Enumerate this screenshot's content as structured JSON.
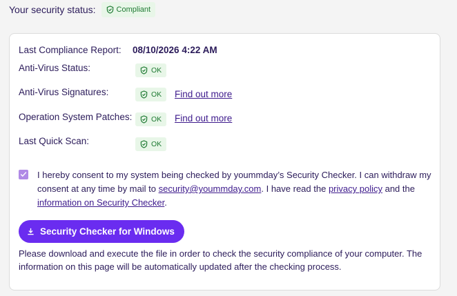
{
  "security_status": {
    "label": "Your security status:",
    "badge": "Compliant"
  },
  "report": {
    "last_compliance": {
      "label": "Last Compliance Report:",
      "value": "08/10/2026 4:22 AM"
    },
    "items": [
      {
        "label": "Anti-Virus Status:",
        "status": "OK"
      },
      {
        "label": "Anti-Virus Signatures:",
        "status": "OK",
        "link": "Find out more"
      },
      {
        "label": "Operation System Patches:",
        "status": "OK",
        "link": "Find out more"
      },
      {
        "label": "Last Quick Scan:",
        "status": "OK"
      }
    ]
  },
  "consent": {
    "checked": true,
    "text_1": "I hereby consent to my system being checked by yoummday’s Security Checker. I can withdraw my consent at any time by mail to ",
    "email": "security@yoummday.com",
    "text_2": ". I have read the ",
    "privacy_link": "privacy policy",
    "text_3": " and the ",
    "info_link": "information on Security Checker",
    "text_4": "."
  },
  "download": {
    "label": "Security Checker for Windows"
  },
  "instructions": "Please download and execute the file in order to check the security compliance of your computer. The information on this page will be automatically updated after the checking process.",
  "colors": {
    "accent": "#6a2cf0",
    "ok_bg": "#e8f6e8",
    "ok_text": "#1f7a33",
    "text": "#2b1b5a",
    "checkbox": "#b08ae6"
  },
  "icons": {
    "badge": "shield-check-icon",
    "download": "download-icon",
    "checkbox": "checkmark-icon"
  }
}
